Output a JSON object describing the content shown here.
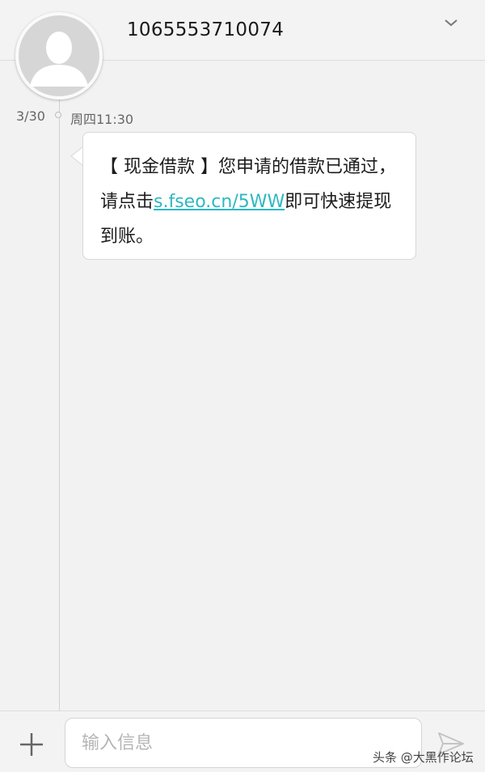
{
  "header": {
    "contact_number": "1065553710074",
    "chevron_icon": "chevron-down-icon"
  },
  "conversation": {
    "date": "3/30",
    "time": "周四11:30",
    "message": {
      "text_before": "【 现金借款 】您申请的借款已通过，请点击",
      "link": "s.fseo.cn/5WW",
      "text_after": "即可快速提现到账。"
    }
  },
  "compose": {
    "placeholder": "输入信息",
    "add_icon": "plus-icon",
    "send_icon": "send-icon"
  },
  "watermark": "头条 @大黑作论坛",
  "colors": {
    "link": "#2db8c2",
    "background": "#f2f2f2",
    "bubble": "#ffffff"
  }
}
